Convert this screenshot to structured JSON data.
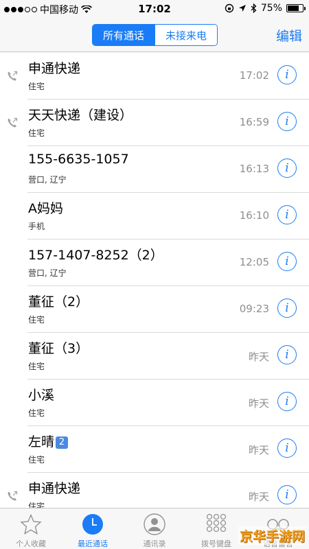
{
  "status_bar": {
    "carrier": "中国移动",
    "time": "17:02",
    "battery": "75%",
    "battery_level": 0.75
  },
  "nav": {
    "segments": [
      "所有通话",
      "未接来电"
    ],
    "active_segment": 0,
    "edit_label": "编辑"
  },
  "calls": [
    {
      "name": "申通快递",
      "sub": "住宅",
      "time": "17:02",
      "outgoing": true
    },
    {
      "name": "天天快递（建设）",
      "sub": "住宅",
      "time": "16:59",
      "outgoing": true
    },
    {
      "name": "155-6635-1057",
      "sub": "营口, 辽宁",
      "time": "16:13",
      "outgoing": false
    },
    {
      "name": "A妈妈",
      "sub": "手机",
      "time": "16:10",
      "outgoing": false
    },
    {
      "name": "157-1407-8252（2）",
      "sub": "营口, 辽宁",
      "time": "12:05",
      "outgoing": false
    },
    {
      "name": "董征（2）",
      "sub": "住宅",
      "time": "09:23",
      "outgoing": false
    },
    {
      "name": "董征（3）",
      "sub": "住宅",
      "time": "昨天",
      "outgoing": false
    },
    {
      "name": "小溪",
      "sub": "住宅",
      "time": "昨天",
      "outgoing": false
    },
    {
      "name": "左晴",
      "badge": "2",
      "sub": "住宅",
      "time": "昨天",
      "outgoing": false
    },
    {
      "name": "申通快递",
      "sub": "住宅",
      "time": "昨天",
      "outgoing": true
    }
  ],
  "info_icon_glyph": "i",
  "tabs": [
    {
      "label": "个人收藏",
      "icon": "star-icon"
    },
    {
      "label": "最近通话",
      "icon": "clock-icon",
      "active": true
    },
    {
      "label": "通讯录",
      "icon": "contact-icon"
    },
    {
      "label": "拨号键盘",
      "icon": "keypad-icon"
    },
    {
      "label": "语音留言",
      "icon": "voicemail-icon"
    }
  ],
  "watermark": "京华手游网",
  "colors": {
    "accent": "#1a7cf6",
    "secondary_text": "#8e8e93"
  }
}
